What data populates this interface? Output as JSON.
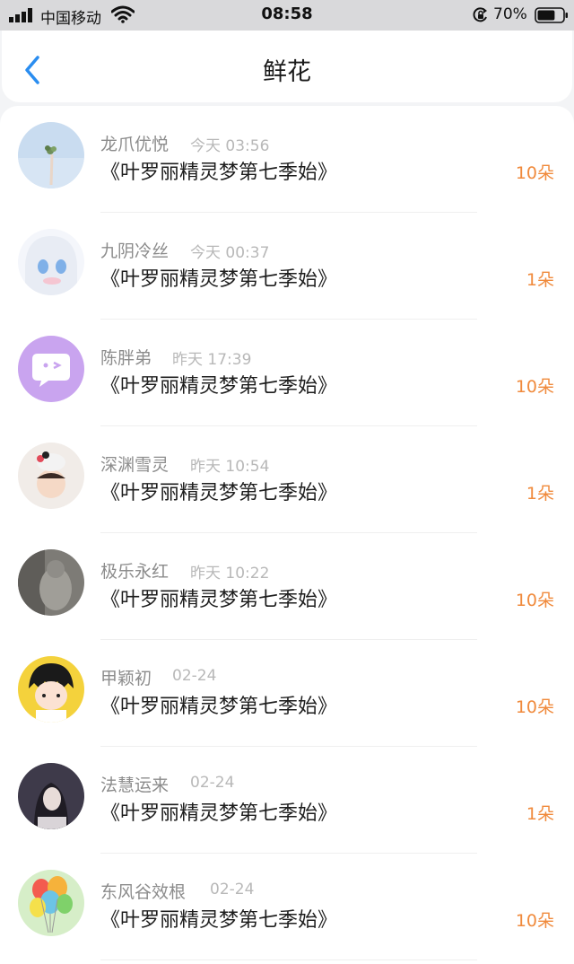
{
  "status_bar": {
    "carrier": "中国移动",
    "time": "08:58",
    "battery_percent": "70%",
    "battery_level": 0.7
  },
  "header": {
    "title": "鲜花",
    "back_icon": "chevron-left-icon",
    "accent_color": "#2a8df0"
  },
  "items": [
    {
      "name": "龙爪优悦",
      "time": "今天 03:56",
      "title": "《叶罗丽精灵梦第七季始》",
      "count": "10朵"
    },
    {
      "name": "九阴冷丝",
      "time": "今天 00:37",
      "title": "《叶罗丽精灵梦第七季始》",
      "count": "1朵"
    },
    {
      "name": "陈胖弟",
      "time": "昨天 17:39",
      "title": "《叶罗丽精灵梦第七季始》",
      "count": "10朵"
    },
    {
      "name": "深渊雪灵",
      "time": "昨天 10:54",
      "title": "《叶罗丽精灵梦第七季始》",
      "count": "1朵"
    },
    {
      "name": "极乐永红",
      "time": "昨天 10:22",
      "title": "《叶罗丽精灵梦第七季始》",
      "count": "10朵"
    },
    {
      "name": "甲颖初",
      "time": "02-24",
      "title": "《叶罗丽精灵梦第七季始》",
      "count": "10朵"
    },
    {
      "name": "法慧运来",
      "time": "02-24",
      "title": "《叶罗丽精灵梦第七季始》",
      "count": "1朵"
    },
    {
      "name": "东风谷效根",
      "time": "02-24",
      "title": "《叶罗丽精灵梦第七季始》",
      "count": "10朵"
    }
  ],
  "count_color": "#f08a3c"
}
